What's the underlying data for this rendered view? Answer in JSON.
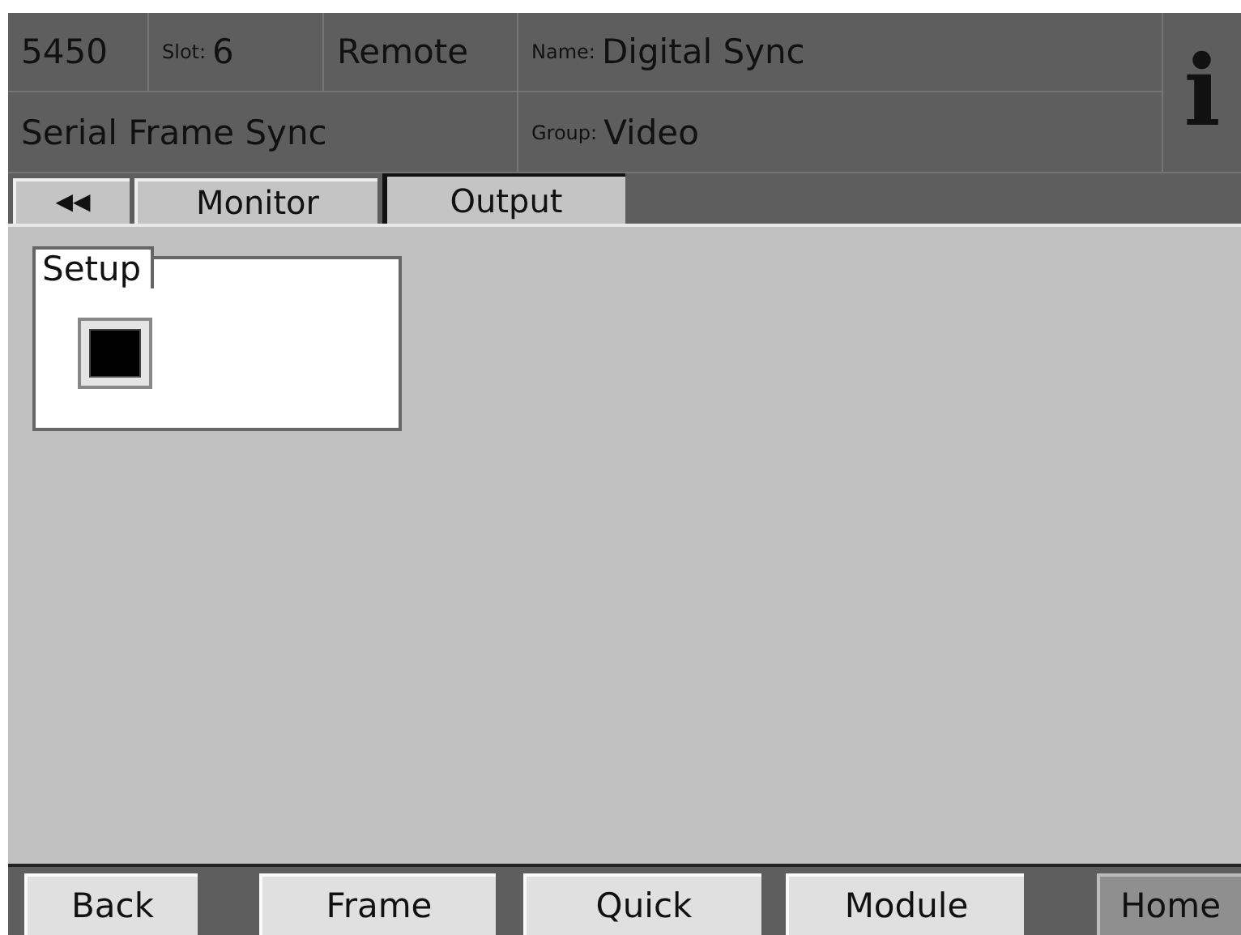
{
  "header": {
    "model": "5450",
    "slot_label": "Slot:",
    "slot": "6",
    "mode": "Remote",
    "name_label": "Name:",
    "name": "Digital Sync",
    "description": "Serial Frame Sync",
    "group_label": "Group:",
    "group": "Video",
    "info": "i"
  },
  "tabs": [
    {
      "label": "◀◀",
      "kind": "back",
      "selected": false
    },
    {
      "label": "Monitor",
      "kind": "tab",
      "selected": false
    },
    {
      "label": "Output",
      "kind": "tab",
      "selected": true
    }
  ],
  "setup": {
    "title": "Setup",
    "checked": true
  },
  "buttons": [
    {
      "label": "Back",
      "selected": false
    },
    {
      "label": "Frame",
      "selected": false
    },
    {
      "label": "Quick",
      "selected": false
    },
    {
      "label": "Module",
      "selected": false
    },
    {
      "label": "Home",
      "selected": true
    }
  ]
}
